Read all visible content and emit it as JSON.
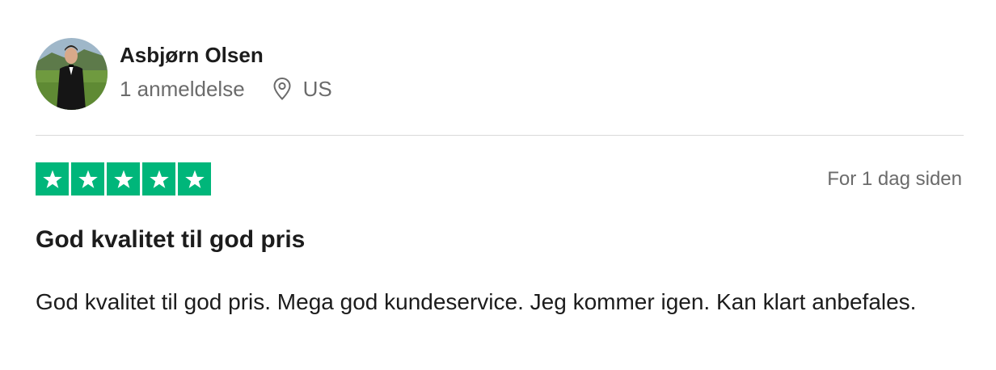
{
  "reviewer": {
    "name": "Asbjørn Olsen",
    "review_count": "1 anmeldelse",
    "location": "US",
    "avatar_icon": "user-photo-avatar"
  },
  "review": {
    "rating": 5,
    "rating_max": 5,
    "star_color": "#00b67a",
    "date": "For 1 dag siden",
    "title": "God kvalitet til god pris",
    "body": "God kvalitet til god pris. Mega god kundeservice. Jeg kommer igen. Kan klart anbefales."
  }
}
